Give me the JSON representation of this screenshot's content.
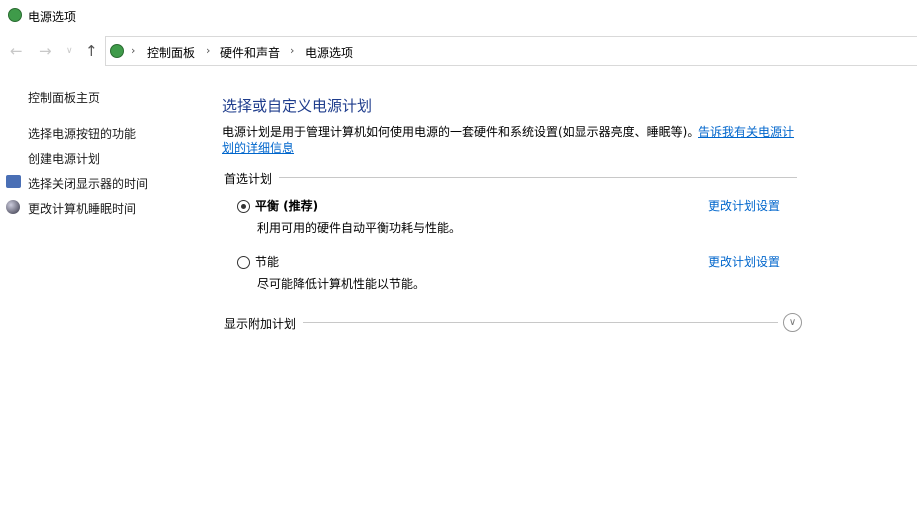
{
  "window": {
    "title": "电源选项"
  },
  "address": {
    "crumbs": [
      "控制面板",
      "硬件和声音",
      "电源选项"
    ]
  },
  "sidebar": {
    "items": [
      {
        "label": "控制面板主页"
      },
      {
        "label": "选择电源按钮的功能"
      },
      {
        "label": "创建电源计划"
      },
      {
        "label": "选择关闭显示器的时间",
        "icon": "display-clock-icon"
      },
      {
        "label": "更改计算机睡眠时间",
        "icon": "moon-icon"
      }
    ]
  },
  "main": {
    "heading": "选择或自定义电源计划",
    "description": "电源计划是用于管理计算机如何使用电源的一套硬件和系统设置(如显示器亮度、睡眠等)。",
    "learn_more_1": "告诉我有关电源计",
    "learn_more_2": "划的详细信息",
    "preferred_section": "首选计划",
    "plans": [
      {
        "name": "平衡 (推荐)",
        "desc": "利用可用的硬件自动平衡功耗与性能。",
        "selected": true,
        "link": "更改计划设置"
      },
      {
        "name": "节能",
        "desc": "尽可能降低计算机性能以节能。",
        "selected": false,
        "link": "更改计划设置"
      }
    ],
    "additional_section": "显示附加计划"
  },
  "colors": {
    "heading": "#1e3c8c",
    "link": "#0066cc"
  }
}
